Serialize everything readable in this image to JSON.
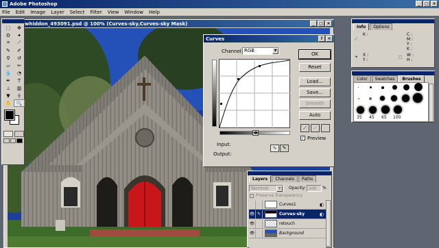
{
  "app": {
    "title": "Adobe Photoshop"
  },
  "menu": [
    "File",
    "Edit",
    "Image",
    "Layer",
    "Select",
    "Filter",
    "View",
    "Window",
    "Help"
  ],
  "image_window": {
    "title": "h_By_swhiddon_493091.psd @ 100% (Curves-sky,Curves-sky Mask)"
  },
  "curves": {
    "title": "Curves",
    "channel_label": "Channel:",
    "channel_value": "RGB",
    "buttons": {
      "ok": "OK",
      "reset": "Reset",
      "load": "Load...",
      "save": "Save...",
      "smooth": "Smooth",
      "auto": "Auto"
    },
    "preview_label": "Preview",
    "preview_checked": true,
    "input_label": "Input:",
    "output_label": "Output:"
  },
  "info_palette": {
    "tabs": [
      "Info",
      "Options"
    ],
    "k_label": "K :",
    "cmyk_labels": [
      "C :",
      "M :",
      "Y :",
      "K :"
    ],
    "xy_labels": [
      "X :",
      "Y :"
    ],
    "wh_labels": [
      "W :",
      "H :"
    ]
  },
  "brushes_palette": {
    "tabs": [
      "Color",
      "Swatches",
      "Brushes"
    ],
    "sizes": [
      "35",
      "45",
      "65",
      "100"
    ]
  },
  "layers_palette": {
    "tabs": [
      "Layers",
      "Channels",
      "Paths"
    ],
    "blend_mode": "Normal",
    "opacity_label": "Opacity:",
    "opacity_value": "100",
    "opacity_unit": "%",
    "preserve_label": "Preserve Transparency",
    "layers": [
      {
        "name": "Curves1"
      },
      {
        "name": "Curves-sky"
      },
      {
        "name": "retouch"
      },
      {
        "name": "Background"
      }
    ]
  },
  "colors": {
    "titlebar": "#0a246a",
    "panel": "#d4d0c8",
    "door": "#c8161b",
    "sky": "#1b3f9a"
  }
}
